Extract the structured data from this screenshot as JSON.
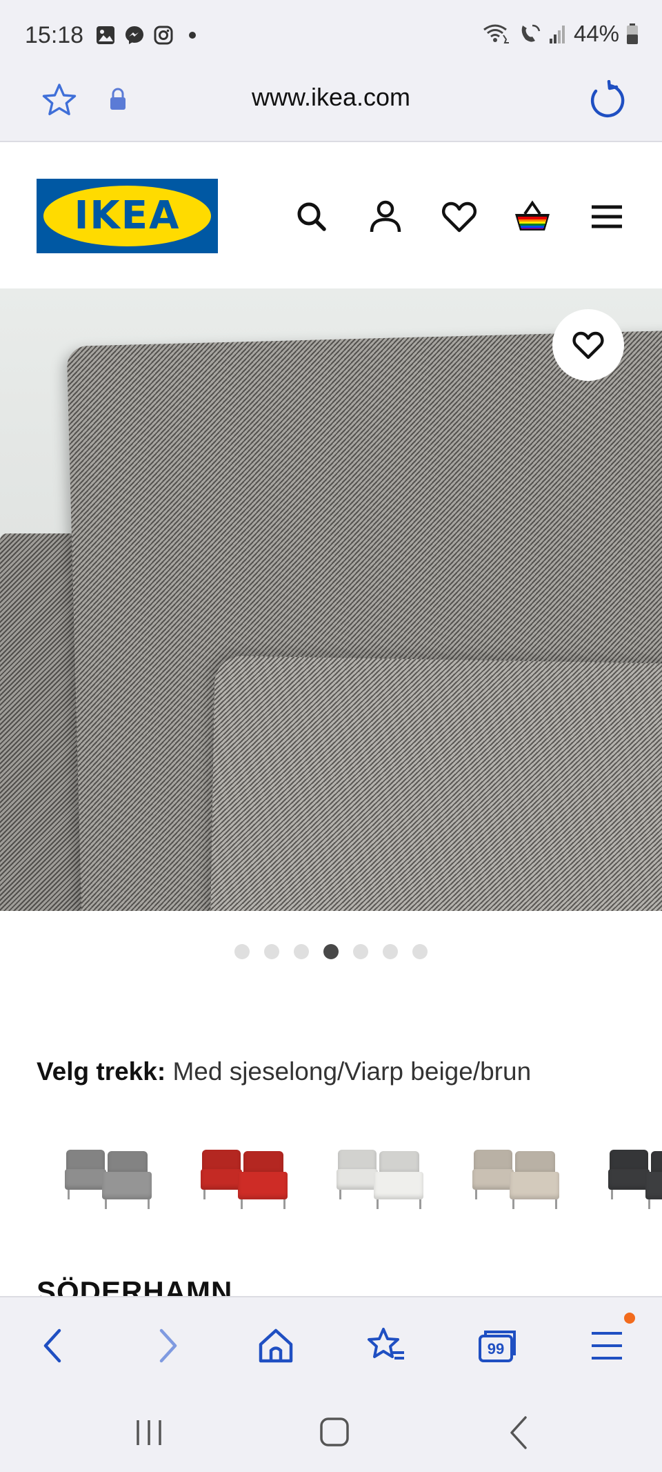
{
  "status_bar": {
    "time": "15:18",
    "battery": "44%",
    "icons_left": [
      "gallery-icon",
      "messenger-icon",
      "instagram-icon"
    ],
    "icons_right": [
      "wifi-calling-icon",
      "volte-icon",
      "signal-icon",
      "battery-icon"
    ]
  },
  "browser": {
    "url": "www.ikea.com",
    "icons": [
      "bookmark-star-icon",
      "lock-icon",
      "reload-icon"
    ]
  },
  "site_header": {
    "logo_text": "IKEA",
    "icons": [
      "search-icon",
      "account-icon",
      "wishlist-heart-icon",
      "shopping-basket-icon",
      "menu-icon"
    ]
  },
  "gallery": {
    "image_count": 7,
    "active_index": 3,
    "favourite_icon": "heart-icon"
  },
  "product": {
    "choose_cover_label": "Velg trekk:",
    "choose_cover_value": "Med sjeselong/Viarp beige/brun",
    "name": "SÖDERHAMN",
    "cover_options": [
      {
        "color": "#8e8e8e"
      },
      {
        "color": "#c42a24"
      },
      {
        "color": "#e4e4e1"
      },
      {
        "color": "#c9c0b3"
      },
      {
        "color": "#3a3b3d"
      }
    ]
  },
  "bottom_nav": {
    "icons": [
      "back-icon",
      "forward-icon",
      "home-icon",
      "bookmarks-icon",
      "tabs-icon",
      "menu-icon"
    ],
    "tabs_count": "99"
  },
  "colors": {
    "accent": "#1f4fc2",
    "ikea_blue": "#0058a3",
    "ikea_yellow": "#ffdb00",
    "badge": "#f26b1d"
  }
}
